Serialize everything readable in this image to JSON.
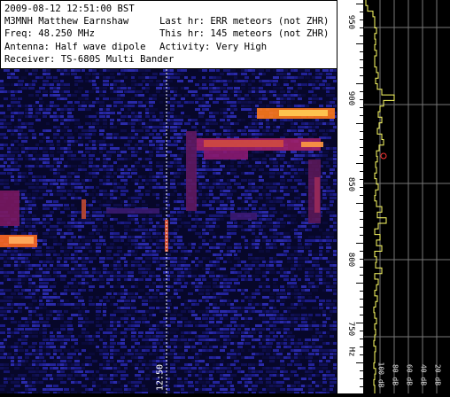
{
  "info": {
    "datetime": "2009-08-12 12:51:00 BST",
    "station": "M3MNH Matthew Earnshaw",
    "freq": "Freq: 48.250 MHz",
    "antenna": "Antenna: Half wave dipole",
    "receiver": "Receiver: TS-680S Multi Bander",
    "last_hr": "Last hr: ERR meteors (not ZHR)",
    "this_hr": "This hr: 145 meteors (not ZHR)",
    "activity": "Activity: Very High"
  },
  "time_marker": "12:50",
  "freq_axis": {
    "labels": [
      "950",
      "900",
      "850",
      "800",
      "750",
      "Hz"
    ]
  },
  "activity_axis": {
    "labels": [
      "100 dB",
      "80 dB",
      "60 dB",
      "40 dB",
      "20 dB"
    ]
  },
  "colors": {
    "background": "#07072a",
    "trace": "#ffff66",
    "peak_marker": "#ff3333",
    "grid": "#888888"
  }
}
